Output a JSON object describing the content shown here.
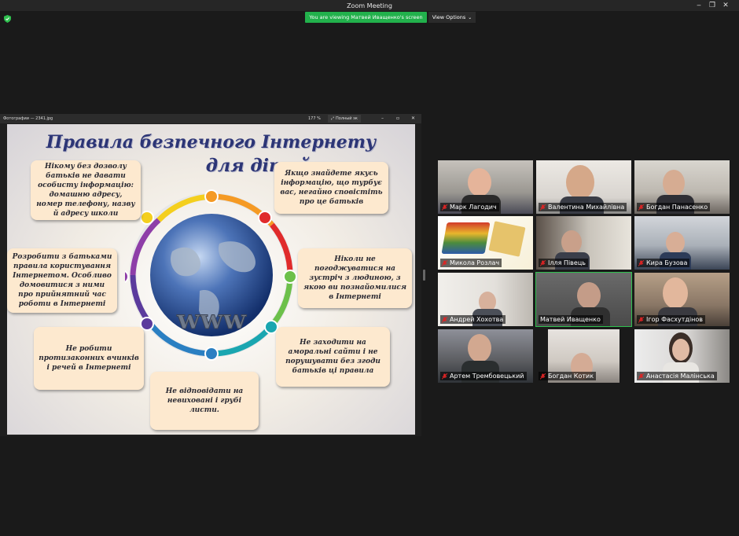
{
  "window": {
    "title": "Zoom Meeting",
    "controls": {
      "minimize": "‒",
      "restore": "❐",
      "close": "✕"
    }
  },
  "banner": {
    "viewing_text": "You are viewing Матвей Иващенко's screen",
    "view_options_label": "View Options",
    "color": "#22b14c"
  },
  "shared_app": {
    "title": "Фотографии — 2341.jpg",
    "zoom": "177 %",
    "fullscreen_label": "Полный эк",
    "minimize": "–",
    "maximize": "▫",
    "close": "✕"
  },
  "poster": {
    "title_line1": "Правила безпечного Інтернету",
    "title_line2": "для дітей",
    "rules": [
      "Нікому без дозволу батьків не давати особисту інформацію: домашню адресу, номер телефону, назву й адресу школи",
      "Якщо знайдете якусь інформацію, що турбує вас, негайно сповістіть про це батьків",
      "Розробити з батьками правила користування Інтернетом. Особливо домовитися з ними про прийнятний час роботи в Інтернеті",
      "Ніколи не погоджуватися на зустріч з людиною, з якою ви познайомилися в Інтернеті",
      "Не робити протизаконних вчинків і речей в Інтернеті",
      "Не заходити на аморальні сайти і не порушувати без згоди батьків ці правила",
      "Не відповідати на невиховані і грубі листи."
    ]
  },
  "participants": [
    {
      "name": "Марк Лагодич",
      "muted": true
    },
    {
      "name": "Валентина Михайлівна",
      "muted": true
    },
    {
      "name": "Богдан Панасенко",
      "muted": true
    },
    {
      "name": "Микола Розлач",
      "muted": true
    },
    {
      "name": "Ілля Півець",
      "muted": true
    },
    {
      "name": "Кира Бузова",
      "muted": true
    },
    {
      "name": "Андрей Хохотва",
      "muted": true
    },
    {
      "name": "Матвей Иващенко",
      "muted": false,
      "active_speaker": true
    },
    {
      "name": "Ігор Фасхутдінов",
      "muted": true
    },
    {
      "name": "Артем Трембовецький",
      "muted": true
    },
    {
      "name": "Богдан Котик",
      "muted": true
    },
    {
      "name": "Анастасія Малінська",
      "muted": true
    }
  ],
  "colors": {
    "active_border": "#2fc04f",
    "muted_icon": "#e02424"
  }
}
